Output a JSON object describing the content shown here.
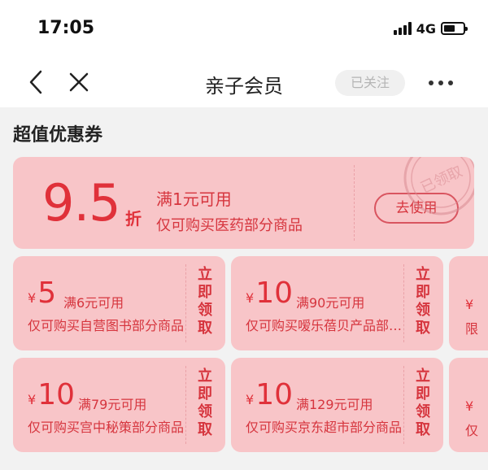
{
  "status_bar": {
    "time": "17:05",
    "network": "4G"
  },
  "nav": {
    "title": "亲子会员",
    "follow_label": "已关注"
  },
  "section": {
    "title": "超值优惠券"
  },
  "big_coupon": {
    "amount": "9.5",
    "unit": "折",
    "condition": "满1元可用",
    "description": "仅可购买医药部分商品",
    "button_label": "去使用",
    "stamp_text": "已领取"
  },
  "coupons": [
    {
      "yen": "¥",
      "amount": "5",
      "condition": "满6元可用",
      "description": "仅可购买自营图书部分商品",
      "claim_label": "立即领取"
    },
    {
      "yen": "¥",
      "amount": "10",
      "condition": "满90元可用",
      "description": "仅可购买嗳乐蓓贝产品部分商品",
      "claim_label": "立即领取"
    },
    {
      "yen": "¥",
      "amount": "10",
      "condition": "满79元可用",
      "description": "仅可购买宫中秘策部分商品",
      "claim_label": "立即领取"
    },
    {
      "yen": "¥",
      "amount": "10",
      "condition": "满129元可用",
      "description": "仅可购买京东超市部分商品",
      "claim_label": "立即领取"
    }
  ],
  "peek_coupons": [
    {
      "yen": "¥",
      "description_start": "限"
    },
    {
      "yen": "¥",
      "description_start": "仅"
    }
  ],
  "colors": {
    "coupon_bg": "#f8c5c8",
    "accent_red": "#e0313a"
  },
  "icons": [
    "back-icon",
    "close-icon",
    "more-icon",
    "signal-icon",
    "battery-icon",
    "claimed-stamp-icon"
  ]
}
